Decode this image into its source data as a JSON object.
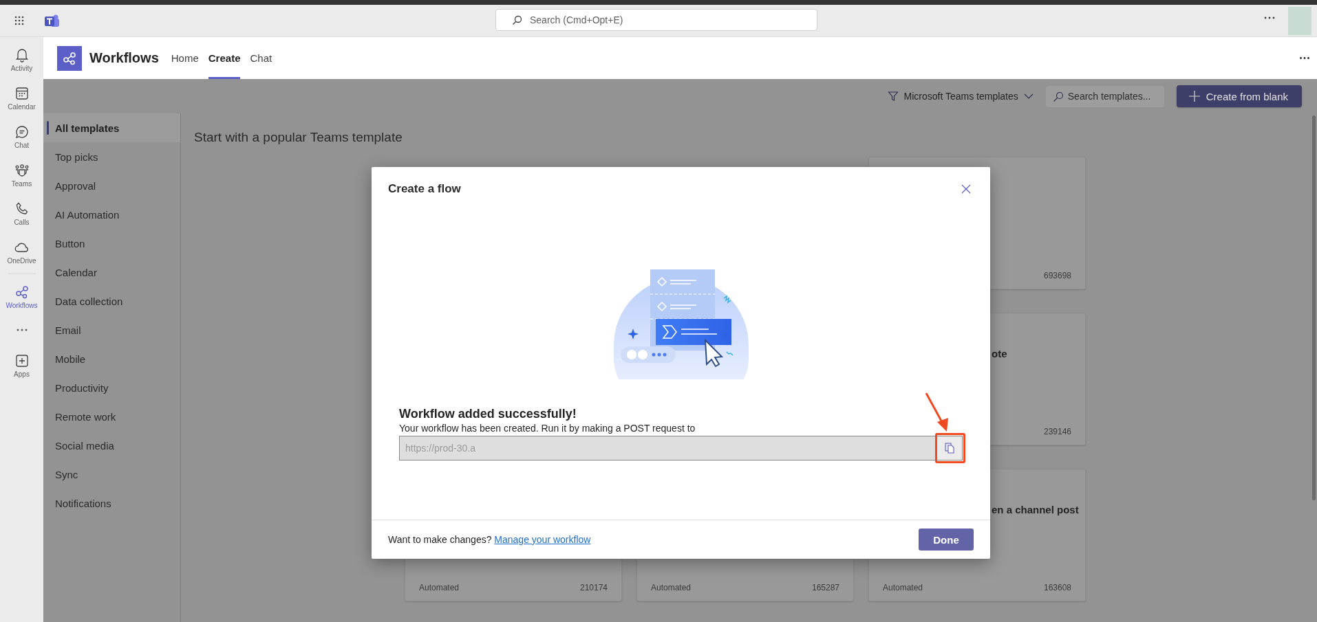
{
  "title_bar": {
    "search": {
      "placeholder": "Search (Cmd+Opt+E)"
    }
  },
  "rail": {
    "items": [
      {
        "label": "Activity",
        "selected": false
      },
      {
        "label": "Calendar",
        "selected": false
      },
      {
        "label": "Chat",
        "selected": false
      },
      {
        "label": "Teams",
        "selected": false
      },
      {
        "label": "Calls",
        "selected": false
      },
      {
        "label": "OneDrive",
        "selected": false
      },
      {
        "label": "Workflows",
        "selected": true
      },
      {
        "label": "Apps",
        "selected": false
      }
    ]
  },
  "app_header": {
    "name": "Workflows",
    "tabs": [
      {
        "label": "Home",
        "selected": false
      },
      {
        "label": "Create",
        "selected": true
      },
      {
        "label": "Chat",
        "selected": false
      }
    ]
  },
  "toolbar": {
    "filter": "Microsoft Teams templates",
    "search": {
      "placeholder": "Search templates..."
    },
    "create_button": "Create from blank"
  },
  "nav": {
    "items": [
      {
        "label": "All templates",
        "selected": true
      },
      {
        "label": "Top picks",
        "selected": false
      },
      {
        "label": "Approval",
        "selected": false
      },
      {
        "label": "AI Automation",
        "selected": false
      },
      {
        "label": "Button",
        "selected": false
      },
      {
        "label": "Calendar",
        "selected": false
      },
      {
        "label": "Data collection",
        "selected": false
      },
      {
        "label": "Email",
        "selected": false
      },
      {
        "label": "Mobile",
        "selected": false
      },
      {
        "label": "Productivity",
        "selected": false
      },
      {
        "label": "Remote work",
        "selected": false
      },
      {
        "label": "Social media",
        "selected": false
      },
      {
        "label": "Sync",
        "selected": false
      },
      {
        "label": "Notifications",
        "selected": false
      }
    ]
  },
  "heading": "Start with a popular Teams template",
  "card_columns": [
    [
      {
        "type": "Automated",
        "count": "210174"
      }
    ],
    [
      {
        "type": "Automated",
        "count": "165287"
      }
    ],
    [
      {
        "count": "693698"
      },
      {
        "title": "ote",
        "count": "239146"
      },
      {
        "title": "en a channel post",
        "type": "Automated",
        "count": "163608"
      }
    ]
  ],
  "dialog": {
    "title": "Create a flow",
    "heading": "Workflow added successfully!",
    "message": "Your workflow has been created. Run it by making a POST request to",
    "url": "https://prod-30.a",
    "footer_text": "Want to make changes?",
    "link": "Manage your workflow",
    "done_button": "Done"
  }
}
